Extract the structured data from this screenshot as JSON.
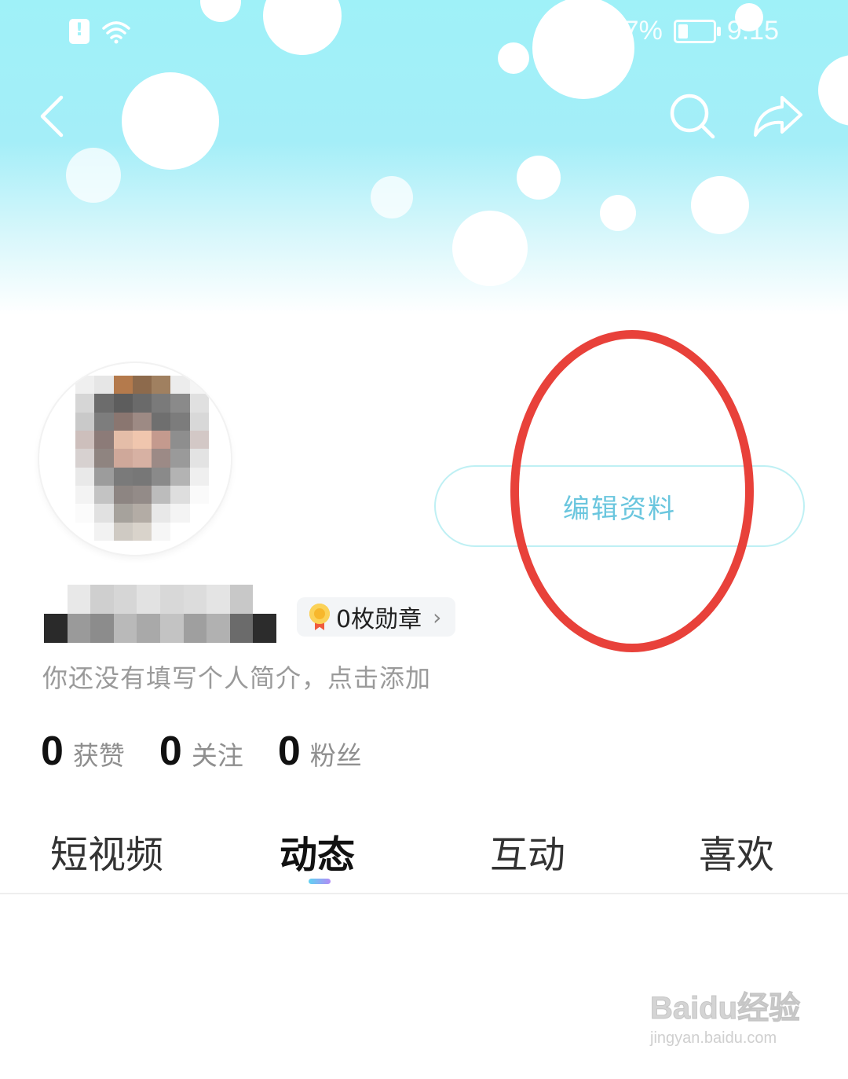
{
  "status_bar": {
    "battery_text": "7%",
    "time": "9:15"
  },
  "profile": {
    "edit_button_label": "编辑资料",
    "badge_text": "0枚勋章",
    "bio_placeholder": "你还没有填写个人简介，点击添加"
  },
  "stats": [
    {
      "value": "0",
      "label": "获赞"
    },
    {
      "value": "0",
      "label": "关注"
    },
    {
      "value": "0",
      "label": "粉丝"
    }
  ],
  "tabs": [
    {
      "label": "短视频",
      "active": false
    },
    {
      "label": "动态",
      "active": true
    },
    {
      "label": "互动",
      "active": false
    },
    {
      "label": "喜欢",
      "active": false
    }
  ],
  "watermark": {
    "brand": "Baidu经验",
    "url": "jingyan.baidu.com"
  },
  "colors": {
    "header_top": "#9ff1f8",
    "accent": "#6ac6de",
    "annotation_red": "#e8413a",
    "tab_indicator_start": "#5fd2f2",
    "tab_indicator_end": "#b28cf5"
  }
}
